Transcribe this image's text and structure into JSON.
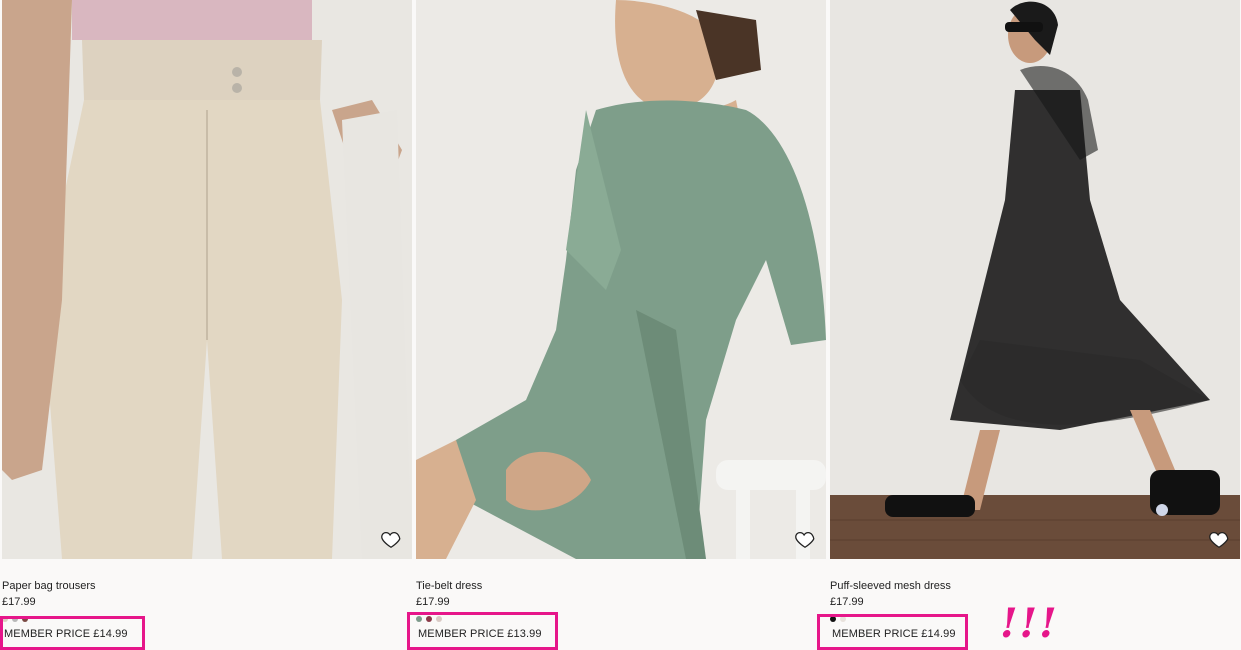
{
  "products": [
    {
      "id": "paper-bag-trousers",
      "name": "Paper bag trousers",
      "price": "£17.99",
      "member_price": "MEMBER PRICE £14.99",
      "swatches": [
        "#d8d0c0",
        "#b8b8b8",
        "#7a4a44"
      ],
      "favorite_icon": "heart-icon"
    },
    {
      "id": "tie-belt-dress",
      "name": "Tie-belt dress",
      "price": "£17.99",
      "member_price": "MEMBER PRICE £13.99",
      "swatches": [
        "#7c9a8a",
        "#8a3a48",
        "#d9c9c4"
      ],
      "favorite_icon": "heart-icon"
    },
    {
      "id": "puff-sleeved-mesh-dress",
      "name": "Puff-sleeved mesh dress",
      "price": "£17.99",
      "member_price": "MEMBER PRICE £14.99",
      "swatches": [
        "#111111",
        "#e8e2dc"
      ],
      "favorite_icon": "heart-icon"
    }
  ],
  "annotation": {
    "exclamation": "!!!",
    "highlight_color": "#e6168a"
  }
}
